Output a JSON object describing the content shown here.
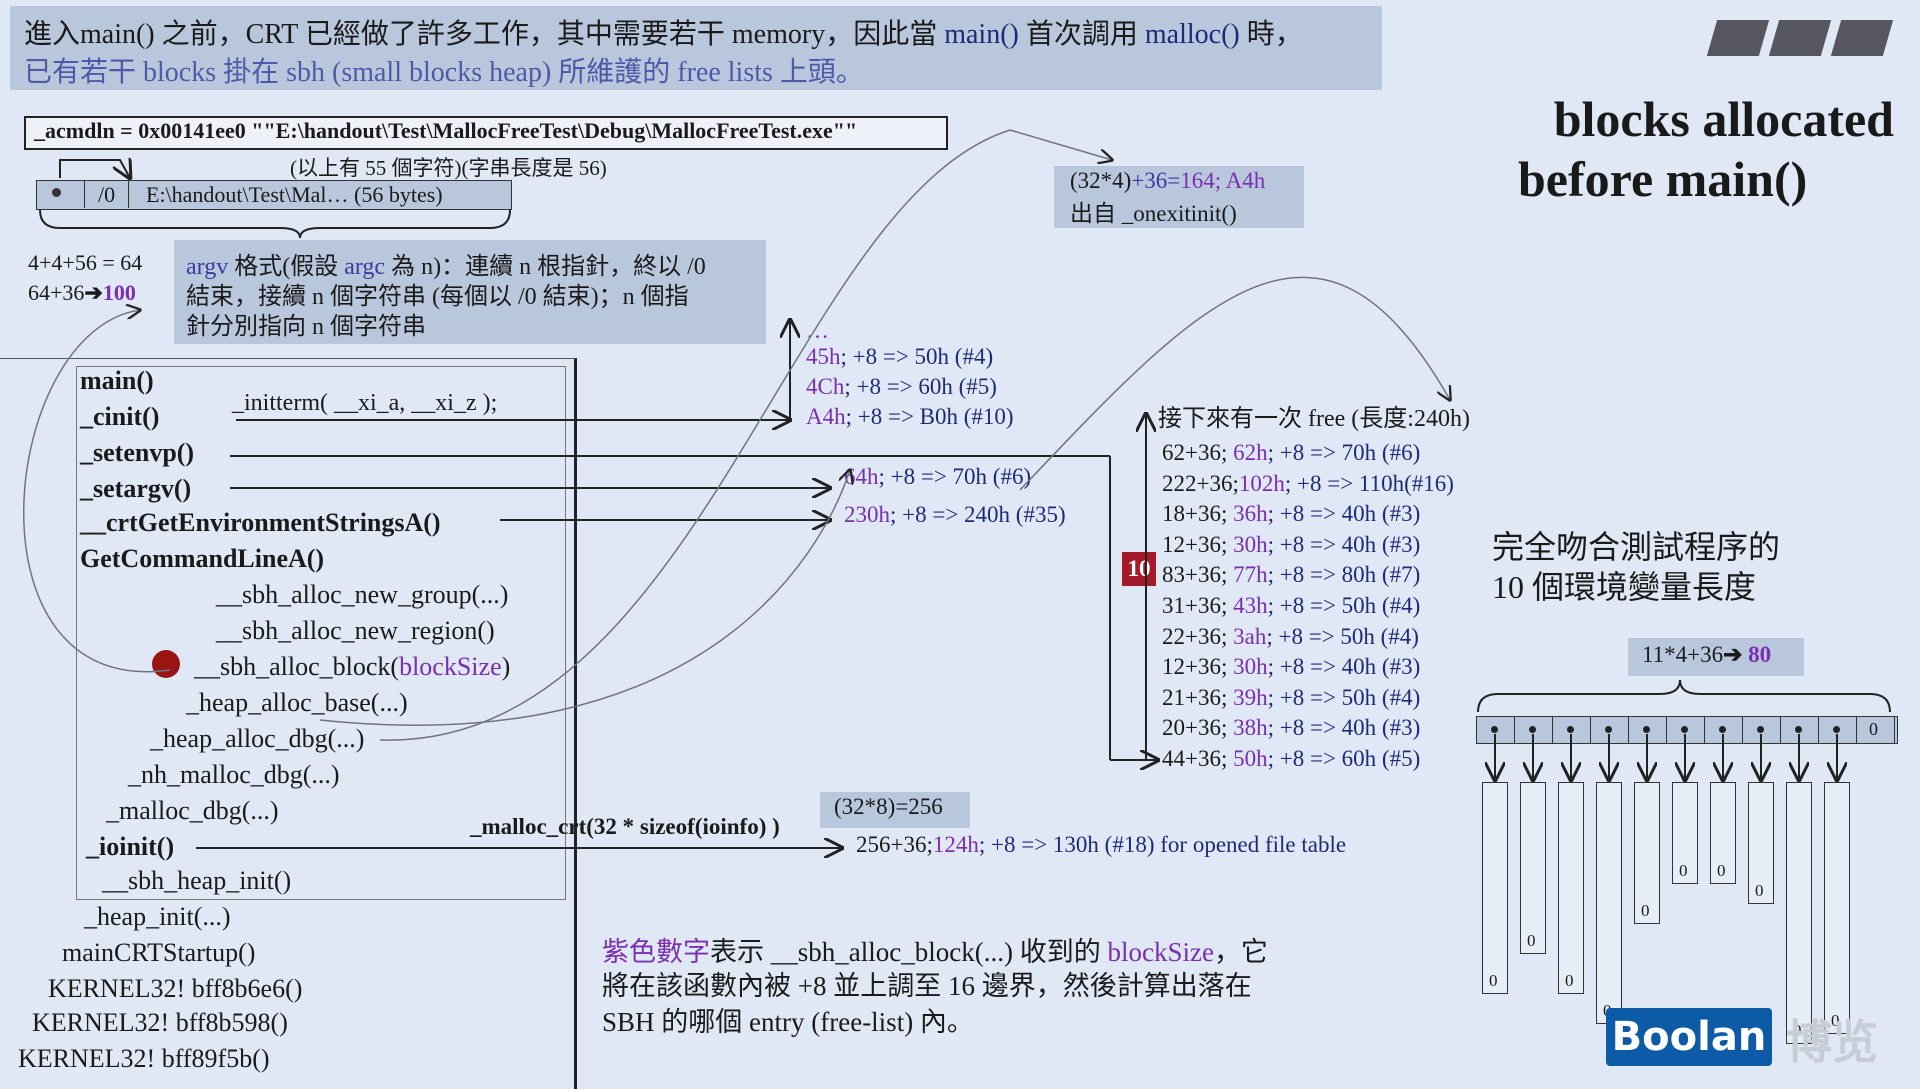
{
  "banner": {
    "line1_a": "進入main() 之前，CRT 已經做了許多工作，其中需要若干 memory，因此當 ",
    "line1_b": "main()",
    "line1_c": " 首次調用 ",
    "line1_d": "malloc()",
    "line1_e": " 時，",
    "line2": "已有若干 blocks 掛在 sbh (small blocks heap) 所維護的 free lists 上頭。"
  },
  "title": {
    "line1": "blocks allocated",
    "line2": "before main()"
  },
  "acmdln": "_acmdln = 0x00141ee0 \"\"E:\\handout\\Test\\MallocFreeTest\\Debug\\MallocFreeTest.exe\"\"",
  "note55": "(以上有 55 個字符)(字串長度是 56)",
  "strbox": {
    "zero": "/0",
    "text": "E:\\handout\\Test\\Mal… (56 bytes)"
  },
  "calc": {
    "line1": "4+4+56 = 64",
    "line2_a": "64+36",
    "line2_arrow": "➔",
    "line2_b": "100"
  },
  "argv_note": {
    "l1_a": "argv",
    "l1_b": " 格式(假設 ",
    "l1_c": "argc",
    "l1_d": " 為 n)：連續 n 根指針，終以 /0",
    "l2": "結束，接續 n 個字符串 (每個以 /0 結束)；n 個指",
    "l3": "針分別指向 n 個字符串"
  },
  "onexit": {
    "l1_a": "(32*4)",
    "l1_b": "+36=",
    "l1_c": "164",
    "l1_d": "; A4h",
    "l2": "出自 _onexitinit()"
  },
  "stack": {
    "main": "main()",
    "cinit": "_cinit()",
    "initterm": "_initterm( __xi_a, __xi_z );",
    "setenvp": "_setenvp()",
    "setargv": "_setargv()",
    "crtenv": "__crtGetEnvironmentStringsA()",
    "getcmd": "GetCommandLineA()",
    "group": "__sbh_alloc_new_group(...)",
    "region": "__sbh_alloc_new_region()",
    "block_a": "__sbh_alloc_block(",
    "block_b": "blockSize",
    "block_c": ")",
    "heapbase": "_heap_alloc_base(...)",
    "heapdbg": "_heap_alloc_dbg(...)",
    "nhmalloc": "_nh_malloc_dbg(...)",
    "mallocdbg": "_malloc_dbg(...)",
    "ioinit": "_ioinit()",
    "sbhinit": "__sbh_heap_init()",
    "heapinit": "_heap_init(...)",
    "startup": "mainCRTStartup()",
    "k1": "KERNEL32! bff8b6e6()",
    "k2": "KERNEL32! bff8b598()",
    "k3": "KERNEL32! bff89f5b()"
  },
  "cinit_allocs": [
    {
      "a": "…",
      "b": ""
    },
    {
      "a": "45h",
      "b": "; +8 => 50h (#4)"
    },
    {
      "a": "4Ch",
      "b": "; +8 => 60h (#5)"
    },
    {
      "a": "A4h",
      "b": "; +8 => B0h (#10)"
    }
  ],
  "setargv_allocs": [
    {
      "a": "64h",
      "b": "; +8 => 70h (#6)"
    },
    {
      "a": "230h",
      "b": "; +8 => 240h (#35)"
    }
  ],
  "free_note": "接下來有一次 free (長度:240h)",
  "badge10": "10",
  "env_allocs": [
    {
      "a": "62+36",
      "b": "; ",
      "c": "62h",
      "d": "; +8 => 70h (#6)"
    },
    {
      "a": "222+36",
      "b": ";",
      "c": "102h",
      "d": "; +8 => 110h(#16)"
    },
    {
      "a": "18+36",
      "b": "; ",
      "c": "36h",
      "d": "; +8 => 40h (#3)"
    },
    {
      "a": "12+36",
      "b": "; ",
      "c": "30h",
      "d": "; +8 => 40h (#3)"
    },
    {
      "a": "83+36",
      "b": "; ",
      "c": "77h",
      "d": "; +8 => 80h (#7)"
    },
    {
      "a": "31+36",
      "b": "; ",
      "c": "43h",
      "d": "; +8 => 50h (#4)"
    },
    {
      "a": "22+36",
      "b": "; ",
      "c": "3ah",
      "d": "; +8 => 50h (#4)"
    },
    {
      "a": "12+36",
      "b": "; ",
      "c": "30h",
      "d": "; +8 => 40h (#3)"
    },
    {
      "a": "21+36",
      "b": "; ",
      "c": "39h",
      "d": "; +8 => 50h (#4)"
    },
    {
      "a": "20+36",
      "b": "; ",
      "c": "38h",
      "d": "; +8 => 40h (#3)"
    },
    {
      "a": "44+36",
      "b": "; ",
      "c": "50h",
      "d": "; +8 => 60h (#5)"
    }
  ],
  "match_note": {
    "l1": "完全吻合測試程序的",
    "l2": "10 個環境變量長度"
  },
  "calc80": {
    "a": "11*4+36",
    "arrow": "➔",
    "b": " 80"
  },
  "ptr_zero": "0",
  "env_zero": "0",
  "cnt288": "(32*8)=256",
  "malloc_crt": "_malloc_crt(32 * sizeof(ioinfo) )",
  "file_table": {
    "a": "256+36;",
    "b": "124h",
    "c": "; +8 => 130h (#18) for opened file table"
  },
  "footer": {
    "l1_a": "紫色數字",
    "l1_b": "表示 __sbh_alloc_block(...) 收到的 ",
    "l1_c": "blockSize",
    "l1_d": "，它",
    "l2": "將在該函數內被 +8 並上調至 16 邊界，然後計算出落在",
    "l3": "SBH 的哪個 entry (free-list) 內。"
  },
  "brand": {
    "boolan": "Boolan",
    "boxian": "博览"
  }
}
